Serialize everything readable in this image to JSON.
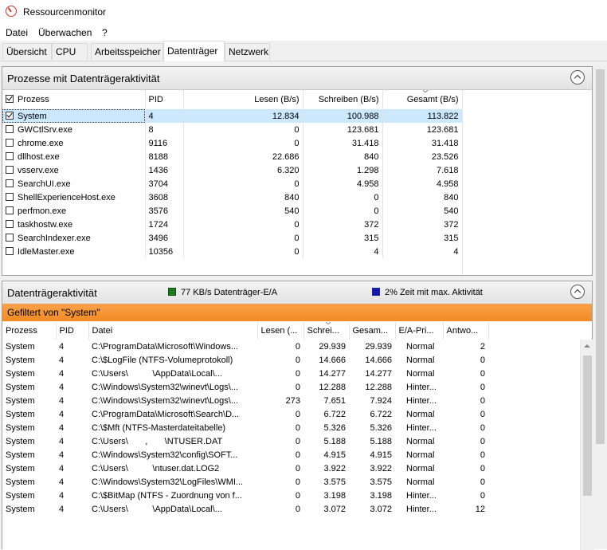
{
  "window": {
    "title": "Ressourcenmonitor"
  },
  "menu": [
    "Datei",
    "Überwachen",
    "?"
  ],
  "tabs": [
    "Übersicht",
    "CPU",
    "Arbeitsspeicher",
    "Datenträger",
    "Netzwerk"
  ],
  "processes": {
    "title": "Prozesse mit Datenträgeraktivität",
    "columns": [
      "Prozess",
      "PID",
      "Lesen (B/s)",
      "Schreiben (B/s)",
      "Gesamt (B/s)"
    ],
    "rows": [
      {
        "name": "System",
        "pid": "4",
        "read": "12.834",
        "write": "100.988",
        "total": "113.822",
        "checked": true
      },
      {
        "name": "GWCtlSrv.exe",
        "pid": "8",
        "read": "0",
        "write": "123.681",
        "total": "123.681",
        "checked": false
      },
      {
        "name": "chrome.exe",
        "pid": "9116",
        "read": "0",
        "write": "31.418",
        "total": "31.418",
        "checked": false
      },
      {
        "name": "dllhost.exe",
        "pid": "8188",
        "read": "22.686",
        "write": "840",
        "total": "23.526",
        "checked": false
      },
      {
        "name": "vsserv.exe",
        "pid": "1436",
        "read": "6.320",
        "write": "1.298",
        "total": "7.618",
        "checked": false
      },
      {
        "name": "SearchUI.exe",
        "pid": "3704",
        "read": "0",
        "write": "4.958",
        "total": "4.958",
        "checked": false
      },
      {
        "name": "ShellExperienceHost.exe",
        "pid": "3608",
        "read": "840",
        "write": "0",
        "total": "840",
        "checked": false
      },
      {
        "name": "perfmon.exe",
        "pid": "3576",
        "read": "540",
        "write": "0",
        "total": "540",
        "checked": false
      },
      {
        "name": "taskhostw.exe",
        "pid": "1724",
        "read": "0",
        "write": "372",
        "total": "372",
        "checked": false
      },
      {
        "name": "SearchIndexer.exe",
        "pid": "3496",
        "read": "0",
        "write": "315",
        "total": "315",
        "checked": false
      },
      {
        "name": "IdleMaster.exe",
        "pid": "10356",
        "read": "0",
        "write": "4",
        "total": "4",
        "checked": false
      }
    ]
  },
  "disk": {
    "title": "Datenträgeraktivität",
    "status1": "77 KB/s Datenträger-E/A",
    "status1_color": "#1e7a1e",
    "status2": "2% Zeit mit max. Aktivität",
    "status2_color": "#1a1aa8",
    "filter": "Gefiltert von \"System\"",
    "columns": [
      "Prozess",
      "PID",
      "Datei",
      "Lesen (...",
      "Schrei...",
      "Gesam...",
      "E/A-Pri...",
      "Antwo..."
    ],
    "rows": [
      {
        "proc": "System",
        "pid": "4",
        "file": "C:\\ProgramData\\Microsoft\\Windows...",
        "read": "0",
        "write": "29.939",
        "total": "29.939",
        "prio": "Normal",
        "resp": "2"
      },
      {
        "proc": "System",
        "pid": "4",
        "file": "C:\\$LogFile (NTFS-Volumeprotokoll)",
        "read": "0",
        "write": "14.666",
        "total": "14.666",
        "prio": "Normal",
        "resp": "0"
      },
      {
        "proc": "System",
        "pid": "4",
        "file": "C:\\Users\\          \\AppData\\Local\\...",
        "read": "0",
        "write": "14.277",
        "total": "14.277",
        "prio": "Normal",
        "resp": "0"
      },
      {
        "proc": "System",
        "pid": "4",
        "file": "C:\\Windows\\System32\\winevt\\Logs\\...",
        "read": "0",
        "write": "12.288",
        "total": "12.288",
        "prio": "Hinter...",
        "resp": "0"
      },
      {
        "proc": "System",
        "pid": "4",
        "file": "C:\\Windows\\System32\\winevt\\Logs\\...",
        "read": "273",
        "write": "7.651",
        "total": "7.924",
        "prio": "Hinter...",
        "resp": "0"
      },
      {
        "proc": "System",
        "pid": "4",
        "file": "C:\\ProgramData\\Microsoft\\Search\\D...",
        "read": "0",
        "write": "6.722",
        "total": "6.722",
        "prio": "Normal",
        "resp": "0"
      },
      {
        "proc": "System",
        "pid": "4",
        "file": "C:\\$Mft (NTFS-Masterdateitabelle)",
        "read": "0",
        "write": "5.326",
        "total": "5.326",
        "prio": "Hinter...",
        "resp": "0"
      },
      {
        "proc": "System",
        "pid": "4",
        "file": "C:\\Users\\       ,       \\NTUSER.DAT",
        "read": "0",
        "write": "5.188",
        "total": "5.188",
        "prio": "Normal",
        "resp": "0"
      },
      {
        "proc": "System",
        "pid": "4",
        "file": "C:\\Windows\\System32\\config\\SOFT...",
        "read": "0",
        "write": "4.915",
        "total": "4.915",
        "prio": "Normal",
        "resp": "0"
      },
      {
        "proc": "System",
        "pid": "4",
        "file": "C:\\Users\\          \\ntuser.dat.LOG2",
        "read": "0",
        "write": "3.922",
        "total": "3.922",
        "prio": "Normal",
        "resp": "0"
      },
      {
        "proc": "System",
        "pid": "4",
        "file": "C:\\Windows\\System32\\LogFiles\\WMI...",
        "read": "0",
        "write": "3.575",
        "total": "3.575",
        "prio": "Normal",
        "resp": "0"
      },
      {
        "proc": "System",
        "pid": "4",
        "file": "C:\\$BitMap (NTFS - Zuordnung von f...",
        "read": "0",
        "write": "3.198",
        "total": "3.198",
        "prio": "Hinter...",
        "resp": "0"
      },
      {
        "proc": "System",
        "pid": "4",
        "file": "C:\\Users\\          \\AppData\\Local\\...",
        "read": "0",
        "write": "3.072",
        "total": "3.072",
        "prio": "Hinter...",
        "resp": "12"
      }
    ]
  }
}
